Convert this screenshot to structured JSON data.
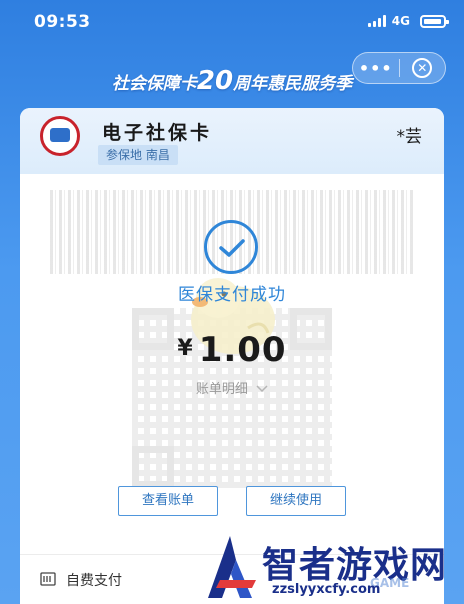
{
  "status_bar": {
    "time": "09:53",
    "network": "4G"
  },
  "capsule": {
    "more_label": "•••"
  },
  "banner": {
    "prefix": "社会保障卡",
    "number": "20",
    "suffix": "周年惠民服务季"
  },
  "card": {
    "title": "电子社保卡",
    "location": "参保地 南昌",
    "user": "*芸"
  },
  "result": {
    "message": "医保支付成功",
    "currency": "¥",
    "amount": "1.00",
    "detail_link": "账单明细"
  },
  "buttons": {
    "view_bill": "查看账单",
    "continue": "继续使用"
  },
  "footer": {
    "label": "自费支付"
  },
  "watermark": {
    "title": "智者游戏网",
    "url": "zzslyyxcfy.com",
    "extra": "GAME"
  },
  "colors": {
    "accent": "#2f86d8",
    "background": "#3f8fe6",
    "header": "#dcecfb"
  }
}
